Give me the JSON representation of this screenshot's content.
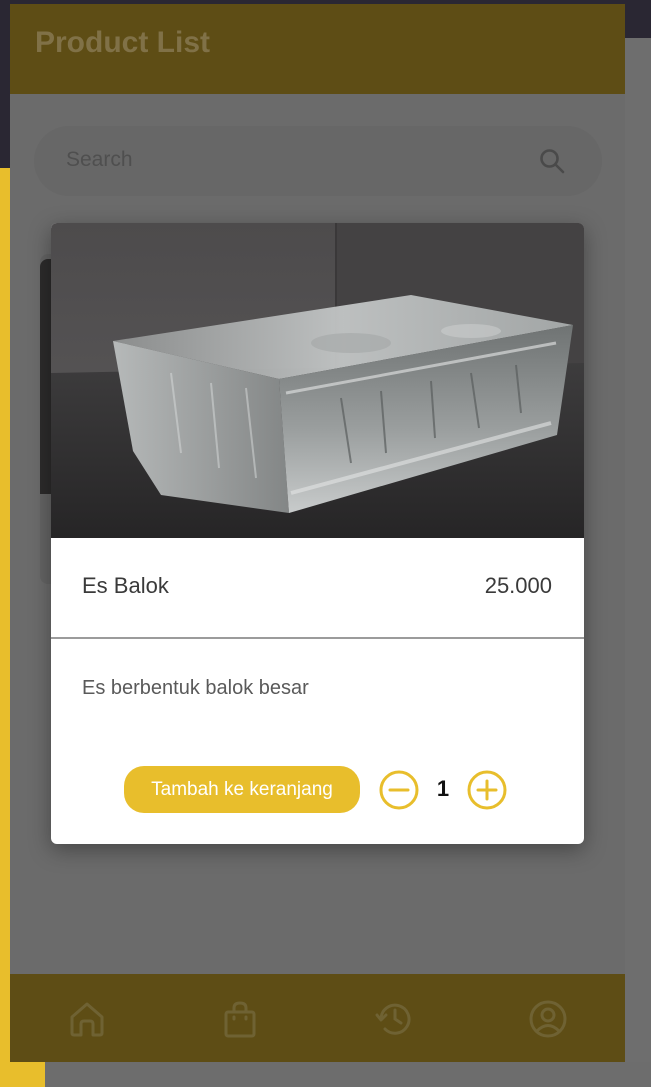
{
  "app": {
    "title": "Product List"
  },
  "search": {
    "placeholder": "Search",
    "icon": "search-icon"
  },
  "dialog": {
    "product_name": "Es Balok",
    "price": "25.000",
    "description": "Es berbentuk balok besar",
    "add_button_label": "Tambah ke keranjang",
    "quantity": "1",
    "image": "ice-block-photo"
  },
  "bottom_nav": {
    "items": [
      {
        "icon": "home-icon"
      },
      {
        "icon": "shopping-bag-icon"
      },
      {
        "icon": "history-icon"
      },
      {
        "icon": "profile-icon"
      }
    ]
  },
  "colors": {
    "accent": "#e8be2c",
    "appbar": "#5e4d15",
    "backdrop": "#2a2733",
    "overlay": "#6b6b6b"
  }
}
